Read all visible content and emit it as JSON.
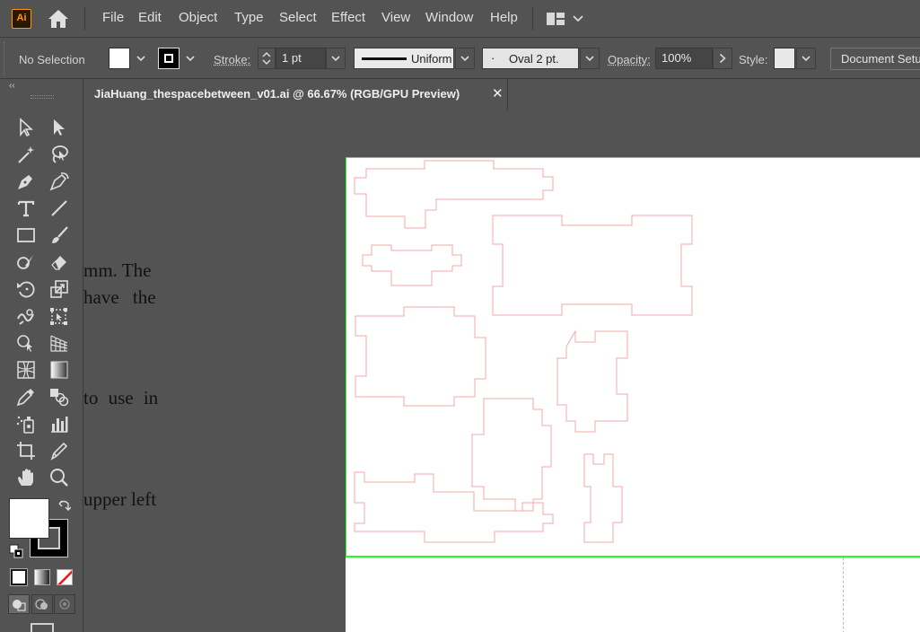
{
  "app": {
    "logo": "Ai"
  },
  "menu": [
    "File",
    "Edit",
    "Object",
    "Type",
    "Select",
    "Effect",
    "View",
    "Window",
    "Help"
  ],
  "control_bar": {
    "selection": "No Selection",
    "stroke_label": "Stroke:",
    "stroke_weight": "1 pt",
    "profile": "Uniform",
    "brush_dot": "·",
    "brush": "Oval 2 pt.",
    "opacity_label": "Opacity:",
    "opacity": "100%",
    "style_label": "Style:",
    "document_setup": "Document Setup"
  },
  "tools_panel": {
    "collapse": "‹‹"
  },
  "document": {
    "tab_title": "JiaHuang_thespacebetween_v01.ai @ 66.67% (RGB/GPU Preview)",
    "close": "✕"
  },
  "background_text": [
    "mm. The",
    "have the",
    "to use in",
    "upper left"
  ],
  "colors": {
    "artboard_border": "#22ff22",
    "cut_lines": "#f2a8a8",
    "fill_swatch": "#ffffff",
    "stroke_swatch": "#000000"
  }
}
